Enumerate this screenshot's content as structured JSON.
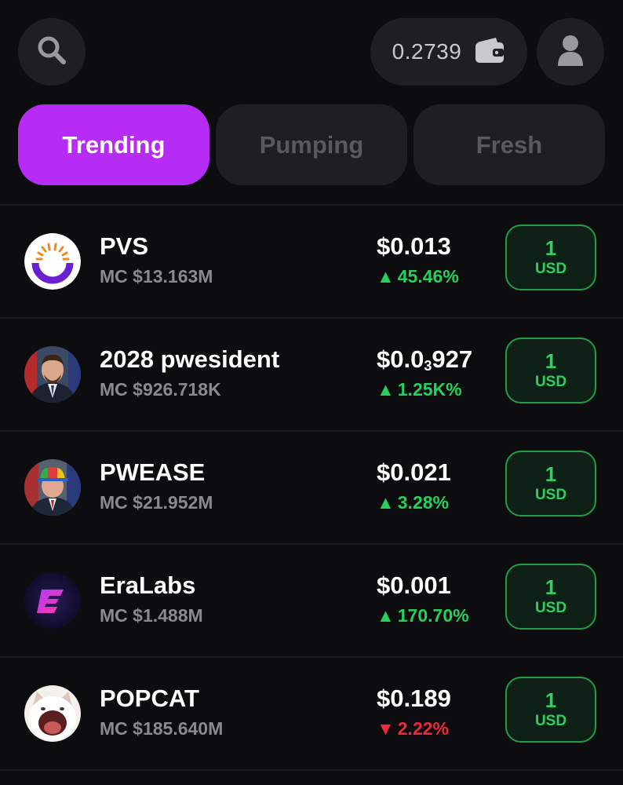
{
  "header": {
    "wallet_balance": "0.2739",
    "search_icon": "search-icon",
    "wallet_icon": "wallet-icon",
    "profile_icon": "user-icon"
  },
  "tabs": [
    {
      "label": "Trending",
      "active": true
    },
    {
      "label": "Pumping",
      "active": false
    },
    {
      "label": "Fresh",
      "active": false
    }
  ],
  "colors": {
    "background": "#0d0d0f",
    "active_tab": "#b72cf5",
    "positive": "#27d05a",
    "negative": "#f0283c",
    "buy_border": "#1f9e45"
  },
  "tokens": [
    {
      "name": "PVS",
      "mc": "MC $13.163M",
      "price_main": "$0.013",
      "price_sub": "",
      "price_tail": "",
      "change": "45.46%",
      "direction": "up",
      "buy_amount": "1",
      "buy_unit": "USD",
      "avatar": "pvs-logo"
    },
    {
      "name": "2028 pwesident",
      "mc": "MC $926.718K",
      "price_main": "$0.0",
      "price_sub": "3",
      "price_tail": "927",
      "change": "1.25K%",
      "direction": "up",
      "buy_amount": "1",
      "buy_unit": "USD",
      "avatar": "portrait-man"
    },
    {
      "name": "PWEASE",
      "mc": "MC $21.952M",
      "price_main": "$0.021",
      "price_sub": "",
      "price_tail": "",
      "change": "3.28%",
      "direction": "up",
      "buy_amount": "1",
      "buy_unit": "USD",
      "avatar": "portrait-man-cap"
    },
    {
      "name": "EraLabs",
      "mc": "MC $1.488M",
      "price_main": "$0.001",
      "price_sub": "",
      "price_tail": "",
      "change": "170.70%",
      "direction": "up",
      "buy_amount": "1",
      "buy_unit": "USD",
      "avatar": "eralabs-logo"
    },
    {
      "name": "POPCAT",
      "mc": "MC $185.640M",
      "price_main": "$0.189",
      "price_sub": "",
      "price_tail": "",
      "change": "2.22%",
      "direction": "down",
      "buy_amount": "1",
      "buy_unit": "USD",
      "avatar": "popcat-image"
    }
  ]
}
